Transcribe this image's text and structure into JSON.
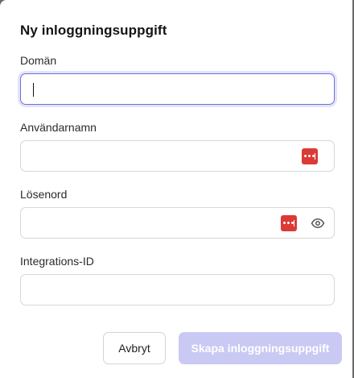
{
  "dialog": {
    "title": "Ny inloggningsuppgift",
    "fields": {
      "domain": {
        "label": "Domän",
        "value": "",
        "placeholder": ""
      },
      "username": {
        "label": "Användarnamn",
        "value": "",
        "placeholder": ""
      },
      "password": {
        "label": "Lösenord",
        "value": "",
        "placeholder": ""
      },
      "integration_id": {
        "label": "Integrations-ID",
        "value": "",
        "placeholder": ""
      }
    },
    "buttons": {
      "cancel": "Avbryt",
      "create": "Skapa inloggningsuppgift"
    }
  },
  "icons": {
    "password_manager": "password-manager-icon",
    "show_password": "eye-icon"
  },
  "colors": {
    "accent_focus": "#6f6fd8",
    "primary_disabled": "#c9c9f4",
    "password_manager": "#dc3a36"
  }
}
